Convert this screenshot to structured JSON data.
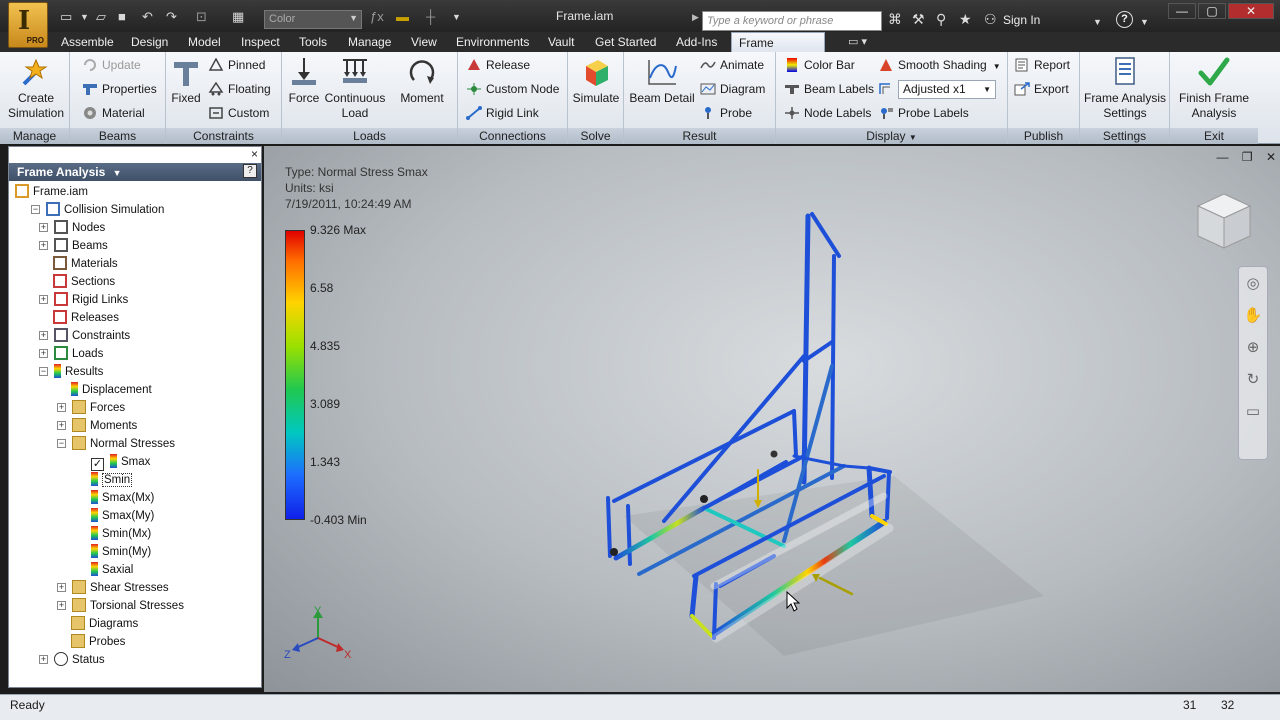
{
  "titlebar": {
    "app_letter": "I",
    "app_edition": "PRO",
    "color_combo": "Color",
    "doc_title": "Frame.iam",
    "search_placeholder": "Type a keyword or phrase",
    "sign_in": "Sign In",
    "help": "?"
  },
  "tabs": [
    "Assemble",
    "Design",
    "Model",
    "Inspect",
    "Tools",
    "Manage",
    "View",
    "Environments",
    "Vault",
    "Get Started",
    "Add-Ins"
  ],
  "active_tab": "Frame Analysis",
  "ribbon": {
    "panels": {
      "manage": "Manage",
      "beams": "Beams",
      "constraints": "Constraints",
      "loads": "Loads",
      "connections": "Connections",
      "solve": "Solve",
      "result": "Result",
      "display": "Display",
      "publish": "Publish",
      "settings": "Settings",
      "exit": "Exit"
    },
    "create_simulation": "Create Simulation",
    "update": "Update",
    "properties": "Properties",
    "material": "Material",
    "fixed": "Fixed",
    "pinned": "Pinned",
    "floating": "Floating",
    "custom": "Custom",
    "force": "Force",
    "continuous_load": "Continuous Load",
    "moment": "Moment",
    "release": "Release",
    "custom_node": "Custom Node",
    "rigid_link": "Rigid Link",
    "simulate": "Simulate",
    "beam_detail": "Beam Detail",
    "animate": "Animate",
    "diagram": "Diagram",
    "probe": "Probe",
    "color_bar": "Color Bar",
    "beam_labels": "Beam Labels",
    "node_labels": "Node Labels",
    "smooth_shading": "Smooth Shading",
    "adjusted": "Adjusted x1",
    "probe_labels": "Probe Labels",
    "report": "Report",
    "export": "Export",
    "frame_analysis_settings": "Frame Analysis Settings",
    "finish_frame_analysis": "Finish Frame Analysis"
  },
  "browser": {
    "title": "Frame Analysis",
    "help": "?",
    "close": "×",
    "tree": [
      {
        "label": "Frame.iam",
        "level": 0,
        "icon": "assembly-icon",
        "exp": ""
      },
      {
        "label": "Collision Simulation",
        "level": 1,
        "icon": "simulation-icon",
        "exp": "−"
      },
      {
        "label": "Nodes",
        "level": 2,
        "icon": "nodes-icon",
        "exp": "+"
      },
      {
        "label": "Beams",
        "level": 2,
        "icon": "beams-icon",
        "exp": "+"
      },
      {
        "label": "Materials",
        "level": 2,
        "icon": "materials-icon",
        "exp": ""
      },
      {
        "label": "Sections",
        "level": 2,
        "icon": "sections-icon",
        "exp": ""
      },
      {
        "label": "Rigid Links",
        "level": 2,
        "icon": "rigid-links-icon",
        "exp": "+"
      },
      {
        "label": "Releases",
        "level": 2,
        "icon": "releases-icon",
        "exp": ""
      },
      {
        "label": "Constraints",
        "level": 2,
        "icon": "constraints-icon",
        "exp": "+"
      },
      {
        "label": "Loads",
        "level": 2,
        "icon": "loads-icon",
        "exp": "+"
      },
      {
        "label": "Results",
        "level": 2,
        "icon": "results-icon",
        "exp": "−"
      },
      {
        "label": "Displacement",
        "level": 3,
        "icon": "result-icon",
        "exp": ""
      },
      {
        "label": "Forces",
        "level": 3,
        "icon": "folder-icon",
        "exp": "+"
      },
      {
        "label": "Moments",
        "level": 3,
        "icon": "folder-icon",
        "exp": "+"
      },
      {
        "label": "Normal Stresses",
        "level": 3,
        "icon": "folder-icon",
        "exp": "−"
      },
      {
        "label": "Smax",
        "level": 4,
        "icon": "result-icon",
        "exp": "",
        "checked": true
      },
      {
        "label": "Smin",
        "level": 4,
        "icon": "result-icon",
        "exp": "",
        "selected": true
      },
      {
        "label": "Smax(Mx)",
        "level": 4,
        "icon": "result-icon",
        "exp": ""
      },
      {
        "label": "Smax(My)",
        "level": 4,
        "icon": "result-icon",
        "exp": ""
      },
      {
        "label": "Smin(Mx)",
        "level": 4,
        "icon": "result-icon",
        "exp": ""
      },
      {
        "label": "Smin(My)",
        "level": 4,
        "icon": "result-icon",
        "exp": ""
      },
      {
        "label": "Saxial",
        "level": 4,
        "icon": "result-icon",
        "exp": ""
      },
      {
        "label": "Shear Stresses",
        "level": 3,
        "icon": "folder-icon",
        "exp": "+"
      },
      {
        "label": "Torsional Stresses",
        "level": 3,
        "icon": "folder-icon",
        "exp": "+"
      },
      {
        "label": "Diagrams",
        "level": 3,
        "icon": "folder-icon",
        "exp": ""
      },
      {
        "label": "Probes",
        "level": 3,
        "icon": "folder-icon",
        "exp": ""
      },
      {
        "label": "Status",
        "level": 2,
        "icon": "info-icon",
        "exp": "+"
      }
    ]
  },
  "viewport": {
    "type_line": "Type: Normal Stress Smax",
    "units_line": "Units: ksi",
    "date_line": "7/19/2011, 10:24:49 AM",
    "color_labels": [
      "9.326 Max",
      "6.58",
      "4.835",
      "3.089",
      "1.343",
      "-0.403 Min"
    ],
    "axis_x": "X",
    "axis_y": "Y",
    "axis_z": "Z"
  },
  "status": {
    "text": "Ready",
    "n1": "31",
    "n2": "32"
  },
  "colors": {
    "accent_blue": "#1d4fd8",
    "ribbon_bg": "#e8edf3",
    "titlebar_bg": "#2b2b2b"
  }
}
